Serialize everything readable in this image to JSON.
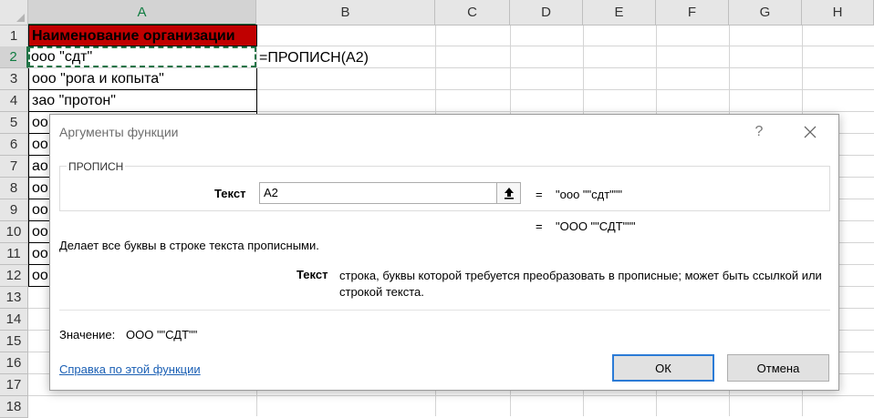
{
  "spreadsheet": {
    "columns": [
      "A",
      "B",
      "C",
      "D",
      "E",
      "F",
      "G",
      "H"
    ],
    "rows": [
      "1",
      "2",
      "3",
      "4",
      "5",
      "6",
      "7",
      "8",
      "9",
      "10",
      "11",
      "12",
      "13",
      "14",
      "15",
      "16",
      "17",
      "18"
    ],
    "cells": {
      "a1": "Наименование организации",
      "a2": "ооо \"сдт\"",
      "a3": "ооо \"рога и копыта\"",
      "a4": "зао \"протон\"",
      "a5": "оо",
      "a6": "оо",
      "a7": "ао",
      "a8": "оо",
      "a9": "оо",
      "a10": "оо",
      "a11": "оо",
      "a12": "оо"
    },
    "formula": "=ПРОПИСН(A2)",
    "colors": {
      "header_fill": "#c00000",
      "selection": "#217346"
    }
  },
  "dialog": {
    "title": "Аргументы функции",
    "help": "?",
    "function_name": "ПРОПИСН",
    "arg_label": "Текст",
    "arg_value": "A2",
    "eq": "=",
    "arg_result": "\"ооо \"\"сдт\"\"\"",
    "formula_result": "\"ООО \"\"СДТ\"\"\"",
    "description": "Делает все буквы в строке текста прописными.",
    "arg_desc_label": "Текст",
    "arg_desc_text": "строка, буквы которой требуется преобразовать в прописные; может быть ссылкой или строкой текста.",
    "result_label": "Значение:",
    "result_value": "ООО \"\"СДТ\"\"",
    "help_link": "Справка по этой функции",
    "ok": "ОК",
    "cancel": "Отмена",
    "icons": {
      "close": "close-icon",
      "collapse": "collapse-dialog-icon"
    }
  }
}
